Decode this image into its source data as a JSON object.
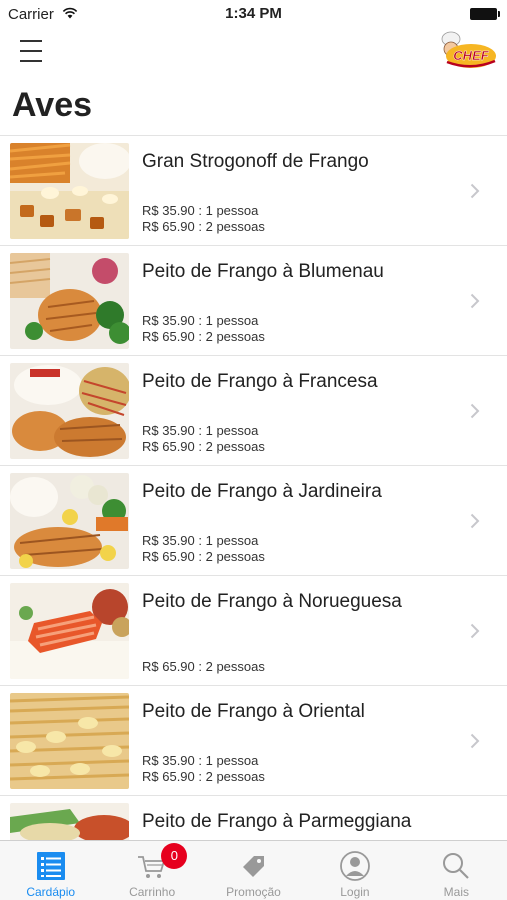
{
  "status": {
    "carrier": "Carrier",
    "time": "1:34 PM"
  },
  "header": {
    "logo_text": "CHEF",
    "title": "Aves"
  },
  "menu_items": [
    {
      "name": "Gran Strogonoff de Frango",
      "price1": "R$ 35.90 : 1 pessoa",
      "price2": "R$ 65.90 : 2 pessoas"
    },
    {
      "name": "Peito de Frango à Blumenau",
      "price1": "R$ 35.90 : 1 pessoa",
      "price2": "R$ 65.90 : 2 pessoas"
    },
    {
      "name": "Peito de Frango à Francesa",
      "price1": "R$ 35.90 : 1 pessoa",
      "price2": "R$ 65.90 : 2 pessoas"
    },
    {
      "name": "Peito de Frango à Jardineira",
      "price1": "R$ 35.90 : 1 pessoa",
      "price2": "R$ 65.90 : 2 pessoas"
    },
    {
      "name": "Peito de Frango à Norueguesa",
      "price1": "",
      "price2": "R$ 65.90 : 2 pessoas"
    },
    {
      "name": "Peito de Frango à Oriental",
      "price1": "R$ 35.90 : 1 pessoa",
      "price2": "R$ 65.90 : 2 pessoas"
    },
    {
      "name": "Peito de Frango à Parmeggiana",
      "price1": "",
      "price2": ""
    }
  ],
  "tabbar": {
    "cardapio": "Cardápio",
    "carrinho": "Carrinho",
    "cart_count": "0",
    "promocao": "Promoção",
    "login": "Login",
    "mais": "Mais"
  },
  "colors": {
    "accent": "#1a8cf0",
    "badge": "#e6001e"
  }
}
